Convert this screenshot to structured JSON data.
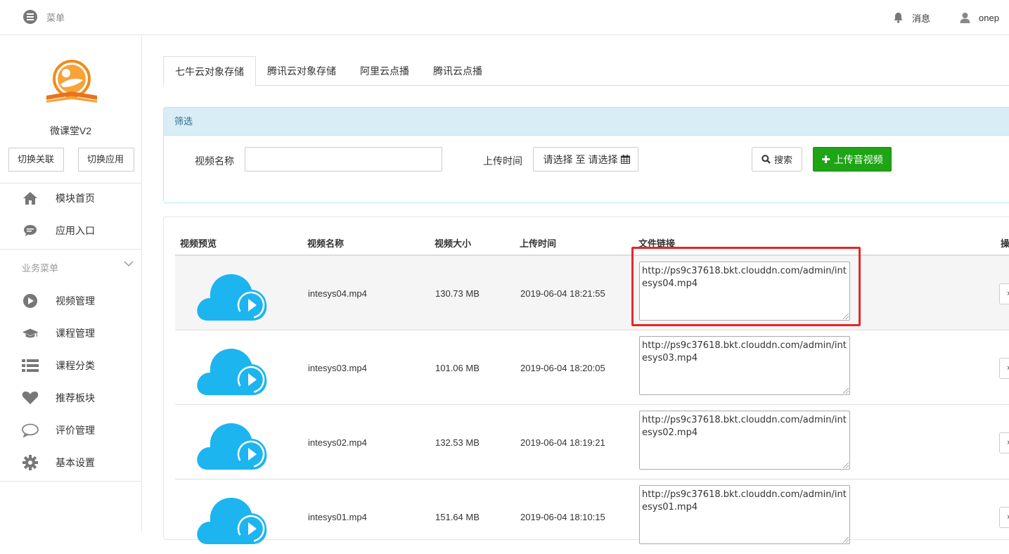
{
  "topbar": {
    "menu_label": "菜单",
    "messages_label": "消息",
    "user_name": "onep"
  },
  "sidebar": {
    "app_name": "微课堂V2",
    "switch_link_label": "切换关联",
    "switch_app_label": "切换应用",
    "items_top": [
      {
        "label": "模块首页",
        "icon": "home-icon"
      },
      {
        "label": "应用入口",
        "icon": "chat-icon"
      }
    ],
    "group_label": "业务菜单",
    "items": [
      {
        "label": "视频管理",
        "icon": "play-circle-icon"
      },
      {
        "label": "课程管理",
        "icon": "graduation-cap-icon"
      },
      {
        "label": "课程分类",
        "icon": "list-icon"
      },
      {
        "label": "推荐板块",
        "icon": "heart-icon"
      },
      {
        "label": "评价管理",
        "icon": "comment-icon"
      },
      {
        "label": "基本设置",
        "icon": "gear-icon"
      }
    ]
  },
  "tabs": [
    "七牛云对象存储",
    "腾讯云对象存储",
    "阿里云点播",
    "腾讯云点播"
  ],
  "filter": {
    "title": "筛选",
    "name_label": "视频名称",
    "name_value": "",
    "time_label": "上传时间",
    "date_from": "请选择",
    "date_sep": "至",
    "date_to": "请选择",
    "search_label": "搜索",
    "upload_label": "上传音视频"
  },
  "table": {
    "headers": [
      "视频预览",
      "视频名称",
      "视频大小",
      "上传时间",
      "文件链接",
      "操"
    ],
    "rows": [
      {
        "name": "intesys04.mp4",
        "size": "130.73 MB",
        "time": "2019-06-04 18:21:55",
        "link": "http://ps9c37618.bkt.clouddn.com/admin/intesys04.mp4",
        "op": "×"
      },
      {
        "name": "intesys03.mp4",
        "size": "101.06 MB",
        "time": "2019-06-04 18:20:05",
        "link": "http://ps9c37618.bkt.clouddn.com/admin/intesys03.mp4",
        "op": "×"
      },
      {
        "name": "intesys02.mp4",
        "size": "132.53 MB",
        "time": "2019-06-04 18:19:21",
        "link": "http://ps9c37618.bkt.clouddn.com/admin/intesys02.mp4",
        "op": "×"
      },
      {
        "name": "intesys01.mp4",
        "size": "151.64 MB",
        "time": "2019-06-04 18:10:15",
        "link": "http://ps9c37618.bkt.clouddn.com/admin/intesys01.mp4",
        "op": "×"
      }
    ]
  },
  "colors": {
    "upload_button": "#1ea414",
    "cloud": "#1cb5ef",
    "highlight": "#e42828",
    "filter_header": "#d9edf7"
  }
}
